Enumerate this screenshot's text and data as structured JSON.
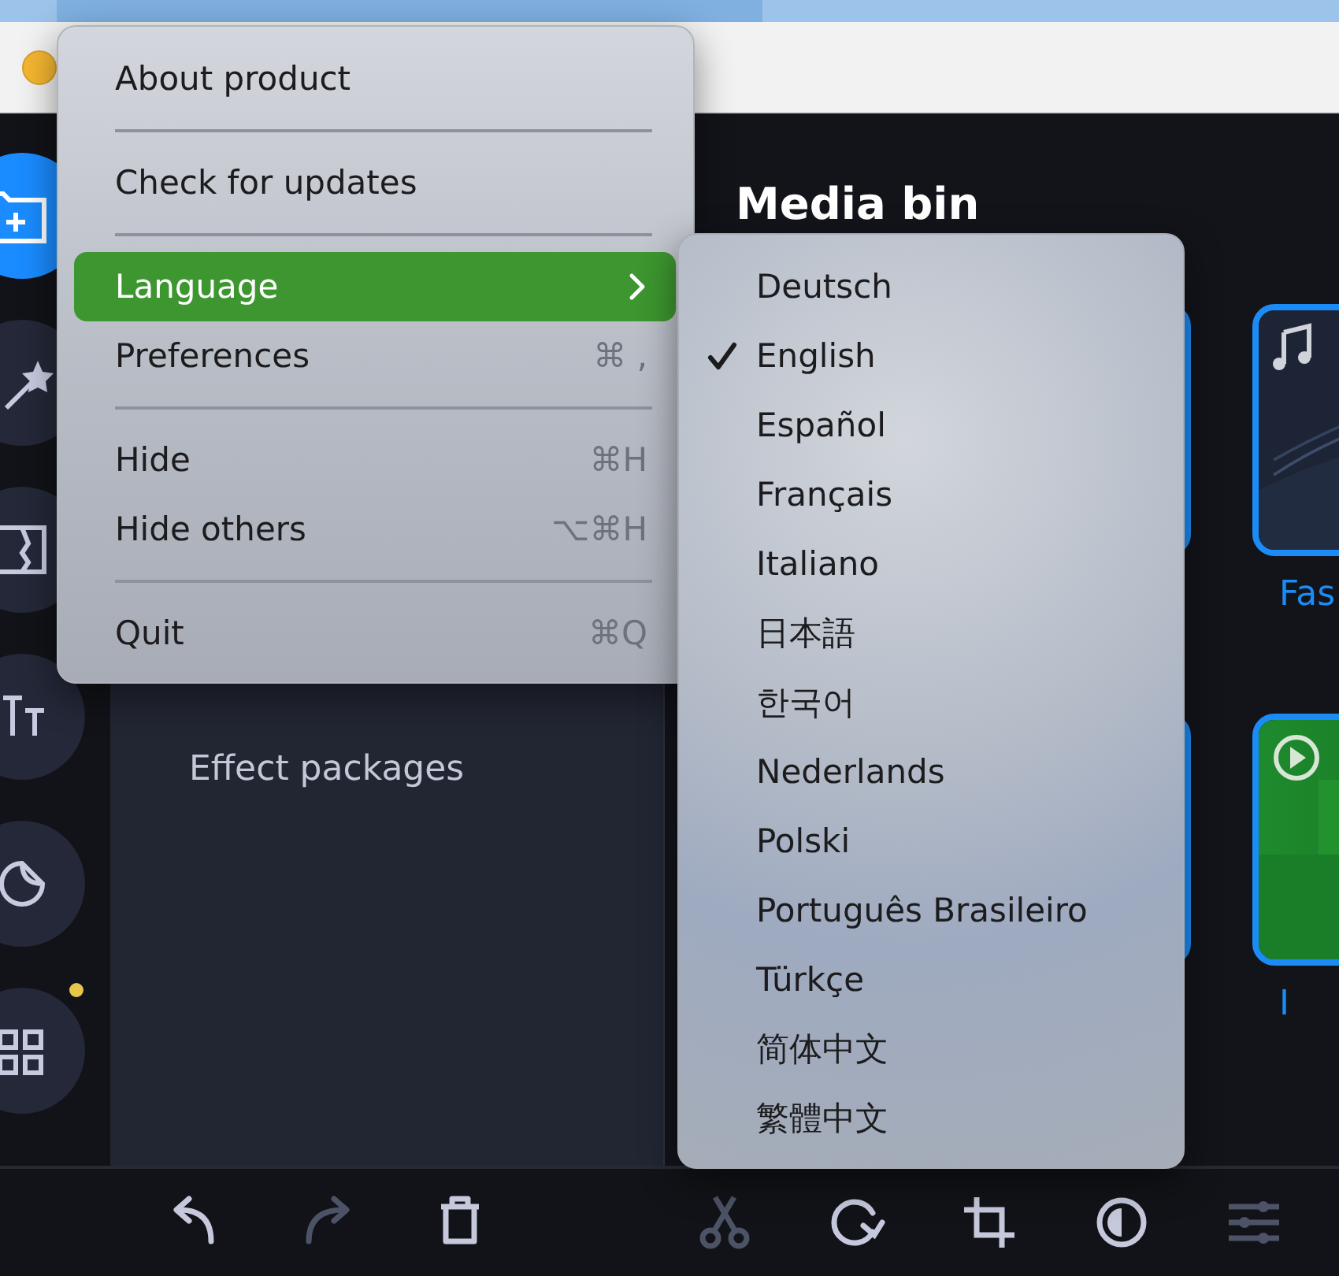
{
  "app_menu": {
    "items": [
      {
        "kind": "item",
        "label": "About product",
        "selected": false
      },
      {
        "kind": "separator"
      },
      {
        "kind": "item",
        "label": "Check for updates",
        "selected": false
      },
      {
        "kind": "separator"
      },
      {
        "kind": "submenu",
        "label": "Language",
        "selected": true
      },
      {
        "kind": "item",
        "label": "Preferences",
        "shortcut": "⌘ ,",
        "selected": false
      },
      {
        "kind": "separator"
      },
      {
        "kind": "item",
        "label": "Hide",
        "shortcut": "⌘H",
        "selected": false
      },
      {
        "kind": "item",
        "label": "Hide others",
        "shortcut": "⌥⌘H",
        "selected": false
      },
      {
        "kind": "separator"
      },
      {
        "kind": "item",
        "label": "Quit",
        "shortcut": "⌘Q",
        "selected": false
      }
    ]
  },
  "language_menu": {
    "items": [
      {
        "label": "Deutsch",
        "checked": false
      },
      {
        "label": "English",
        "checked": true
      },
      {
        "label": "Español",
        "checked": false
      },
      {
        "label": "Français",
        "checked": false
      },
      {
        "label": "Italiano",
        "checked": false
      },
      {
        "label": "日本語",
        "checked": false
      },
      {
        "label": "한국어",
        "checked": false
      },
      {
        "label": "Nederlands",
        "checked": false
      },
      {
        "label": "Polski",
        "checked": false
      },
      {
        "label": "Português Brasileiro",
        "checked": false
      },
      {
        "label": "Türkçe",
        "checked": false
      },
      {
        "label": "简体中文",
        "checked": false
      },
      {
        "label": "繁體中文",
        "checked": false
      }
    ]
  },
  "rail": {
    "items": [
      {
        "kind": "import",
        "selected": true,
        "badge": false
      },
      {
        "kind": "magic",
        "selected": false,
        "badge": false
      },
      {
        "kind": "transition",
        "selected": false,
        "badge": false
      },
      {
        "kind": "text",
        "selected": false,
        "badge": false
      },
      {
        "kind": "sticker",
        "selected": false,
        "badge": false
      },
      {
        "kind": "apps",
        "selected": false,
        "badge": true
      }
    ]
  },
  "panel": {
    "items": [
      {
        "label": "Effect packages"
      }
    ]
  },
  "media_bin": {
    "title": "Media bin",
    "items": [
      {
        "kind": "audio",
        "label": "Fas"
      },
      {
        "kind": "video",
        "label": "I"
      }
    ]
  },
  "toolbar": {
    "groups": [
      [
        {
          "kind": "undo",
          "disabled": false
        },
        {
          "kind": "redo",
          "disabled": true
        },
        {
          "kind": "delete",
          "disabled": false
        }
      ],
      [
        {
          "kind": "cut",
          "disabled": true
        },
        {
          "kind": "rotate",
          "disabled": false
        },
        {
          "kind": "crop",
          "disabled": false
        },
        {
          "kind": "contrast",
          "disabled": false
        },
        {
          "kind": "adjust",
          "disabled": true
        }
      ]
    ]
  }
}
